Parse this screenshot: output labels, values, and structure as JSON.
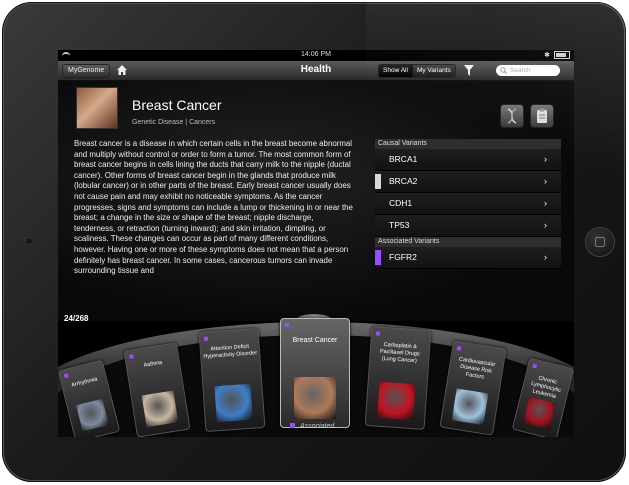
{
  "status_bar": {
    "time": "14:06 PM"
  },
  "nav": {
    "back_label": "MyGenome",
    "title": "Health",
    "segment": [
      "Show All",
      "My Variants"
    ],
    "search_placeholder": "Search"
  },
  "disease": {
    "title": "Breast Cancer",
    "subtitle": "Genetic Disease | Cancers",
    "description": "Breast cancer is a disease in which certain cells in the breast become abnormal and multiply without control or order to form a tumor. The most common form of breast cancer begins in cells lining the ducts that carry milk to the nipple (ductal cancer). Other forms of breast cancer begin in the glands that produce milk (lobular cancer) or in other parts of the breast. Early breast cancer usually does not cause pain and may exhibit no noticeable symptoms. As the cancer progresses, signs and symptoms can include a lump or thickening in or near the breast; a change in the size or shape of the breast; nipple discharge, tenderness, or retraction (turning inward); and skin irritation, dimpling, or scaliness. These changes can occur as part of many different conditions, however. Having one or more of these symptoms does not mean that a person definitely has breast cancer. In some cases, cancerous tumors can invade surrounding tissue and"
  },
  "variants": {
    "causal_header": "Causal Variants",
    "causal": [
      {
        "name": "BRCA1",
        "mark": ""
      },
      {
        "name": "BRCA2",
        "mark": "#d8d8d8"
      },
      {
        "name": "CDH1",
        "mark": ""
      },
      {
        "name": "TP53",
        "mark": ""
      }
    ],
    "associated_header": "Associated Variants",
    "associated": [
      {
        "name": "FGFR2",
        "mark": "#9a4dff"
      }
    ]
  },
  "carousel": {
    "counter": "24/268",
    "cards": [
      {
        "title": "Arrhythmia"
      },
      {
        "title": "Asthma"
      },
      {
        "title": "Attention Deficit Hyperactivity Disorder"
      },
      {
        "title": "Breast Cancer"
      },
      {
        "title": "Carboplatin & Paclitaxel Drugs (Lung Cancer)"
      },
      {
        "title": "Cardiovascular Disease Risk Factors"
      },
      {
        "title": "Chronic Lymphocytic Leukemia"
      }
    ],
    "selected_label": "Associated"
  }
}
